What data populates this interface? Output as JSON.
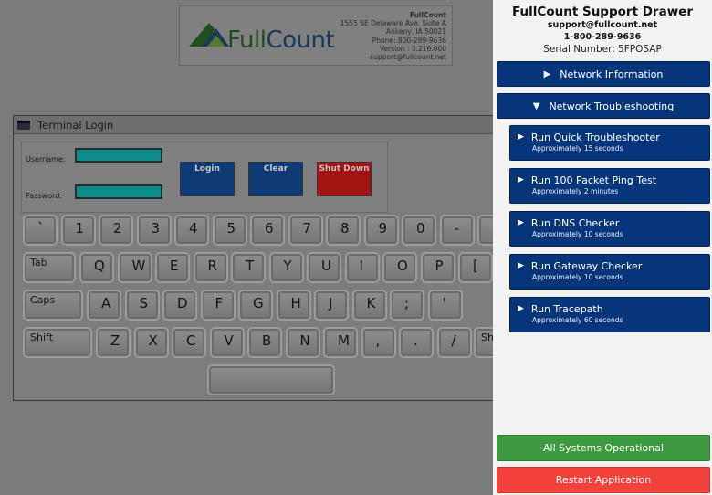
{
  "logo": {
    "brand_a": "Full",
    "brand_b": "Count",
    "company": "FullCount",
    "address1": "1555 SE Delaware Ave. Suite A",
    "address2": "Ankeny, IA 50021",
    "phone": "Phone: 800-289-9636",
    "version": "Version : 3.216.000",
    "email": "support@fullcount.net"
  },
  "terminal": {
    "title": "Terminal Login",
    "username_label": "Username:",
    "password_label": "Password:",
    "username_value": "",
    "password_value": "",
    "login_label": "Login",
    "clear_label": "Clear",
    "shutdown_label": "Shut Down"
  },
  "keyboard": {
    "row1": [
      "`",
      "1",
      "2",
      "3",
      "4",
      "5",
      "6",
      "7",
      "8",
      "9",
      "0",
      "-",
      "="
    ],
    "row2_mod": "Tab",
    "row2": [
      "Q",
      "W",
      "E",
      "R",
      "T",
      "Y",
      "U",
      "I",
      "O",
      "P",
      "["
    ],
    "row3_mod": "Caps",
    "row3": [
      "A",
      "S",
      "D",
      "F",
      "G",
      "H",
      "J",
      "K",
      ";",
      "'"
    ],
    "row4_mod": "Shift",
    "row4": [
      "Z",
      "X",
      "C",
      "V",
      "B",
      "N",
      "M",
      ",",
      ".",
      "/"
    ],
    "row4_right": "Sh"
  },
  "drawer": {
    "title": "FullCount Support Drawer",
    "email": "support@fullcount.net",
    "phone": "1-800-289-9636",
    "serial": "Serial Number: 5FPOSAP",
    "network_info": "Network Information",
    "network_troubleshooting": "Network Troubleshooting",
    "collapsed_arrow": "▶",
    "expanded_arrow": "▼",
    "tools": [
      {
        "label": "Run Quick Troubleshooter",
        "time": "Approximately 15 seconds"
      },
      {
        "label": "Run 100 Packet Ping Test",
        "time": "Approximately 2 minutes"
      },
      {
        "label": "Run DNS Checker",
        "time": "Approximately 10 seconds"
      },
      {
        "label": "Run Gateway Checker",
        "time": "Approximately 10 seconds"
      },
      {
        "label": "Run Tracepath",
        "time": "Approximately 60 seconds"
      }
    ],
    "status": "All Systems Operational",
    "restart": "Restart Application"
  }
}
